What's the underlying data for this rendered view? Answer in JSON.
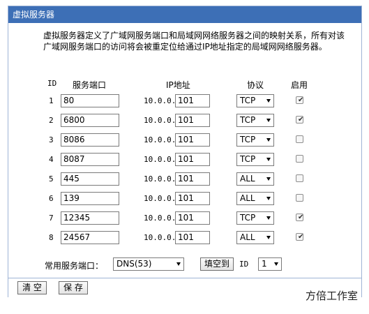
{
  "panel": {
    "title": "虚拟服务器",
    "description": "虚拟服务器定义了广域网服务端口和局域网网络服务器之间的映射关系，所有对该广域网服务端口的访问将会被重定位给通过IP地址指定的局域网网络服务器。"
  },
  "table": {
    "headers": {
      "id": "ID",
      "port": "服务端口",
      "ip": "IP地址",
      "protocol": "协议",
      "enabled": "启用"
    },
    "ip_prefix": "10.0.0.",
    "rows": [
      {
        "id": "1",
        "port": "80",
        "ip_last": "101",
        "protocol": "TCP",
        "enabled": true
      },
      {
        "id": "2",
        "port": "6800",
        "ip_last": "101",
        "protocol": "TCP",
        "enabled": true
      },
      {
        "id": "3",
        "port": "8086",
        "ip_last": "101",
        "protocol": "TCP",
        "enabled": false
      },
      {
        "id": "4",
        "port": "8087",
        "ip_last": "101",
        "protocol": "TCP",
        "enabled": false
      },
      {
        "id": "5",
        "port": "445",
        "ip_last": "101",
        "protocol": "ALL",
        "enabled": false
      },
      {
        "id": "6",
        "port": "139",
        "ip_last": "101",
        "protocol": "ALL",
        "enabled": false
      },
      {
        "id": "7",
        "port": "12345",
        "ip_last": "101",
        "protocol": "TCP",
        "enabled": true
      },
      {
        "id": "8",
        "port": "24567",
        "ip_last": "101",
        "protocol": "ALL",
        "enabled": true
      }
    ]
  },
  "common": {
    "label": "常用服务端口：",
    "selected": "DNS(53)",
    "fill_button": "填空到",
    "id_label": "ID",
    "id_selected": "1"
  },
  "actions": {
    "clear": "清 空",
    "save": "保 存"
  },
  "watermark": "方倍工作室",
  "colors": {
    "title_bar": "#3d6fb6",
    "border": "#9fb4d6"
  }
}
